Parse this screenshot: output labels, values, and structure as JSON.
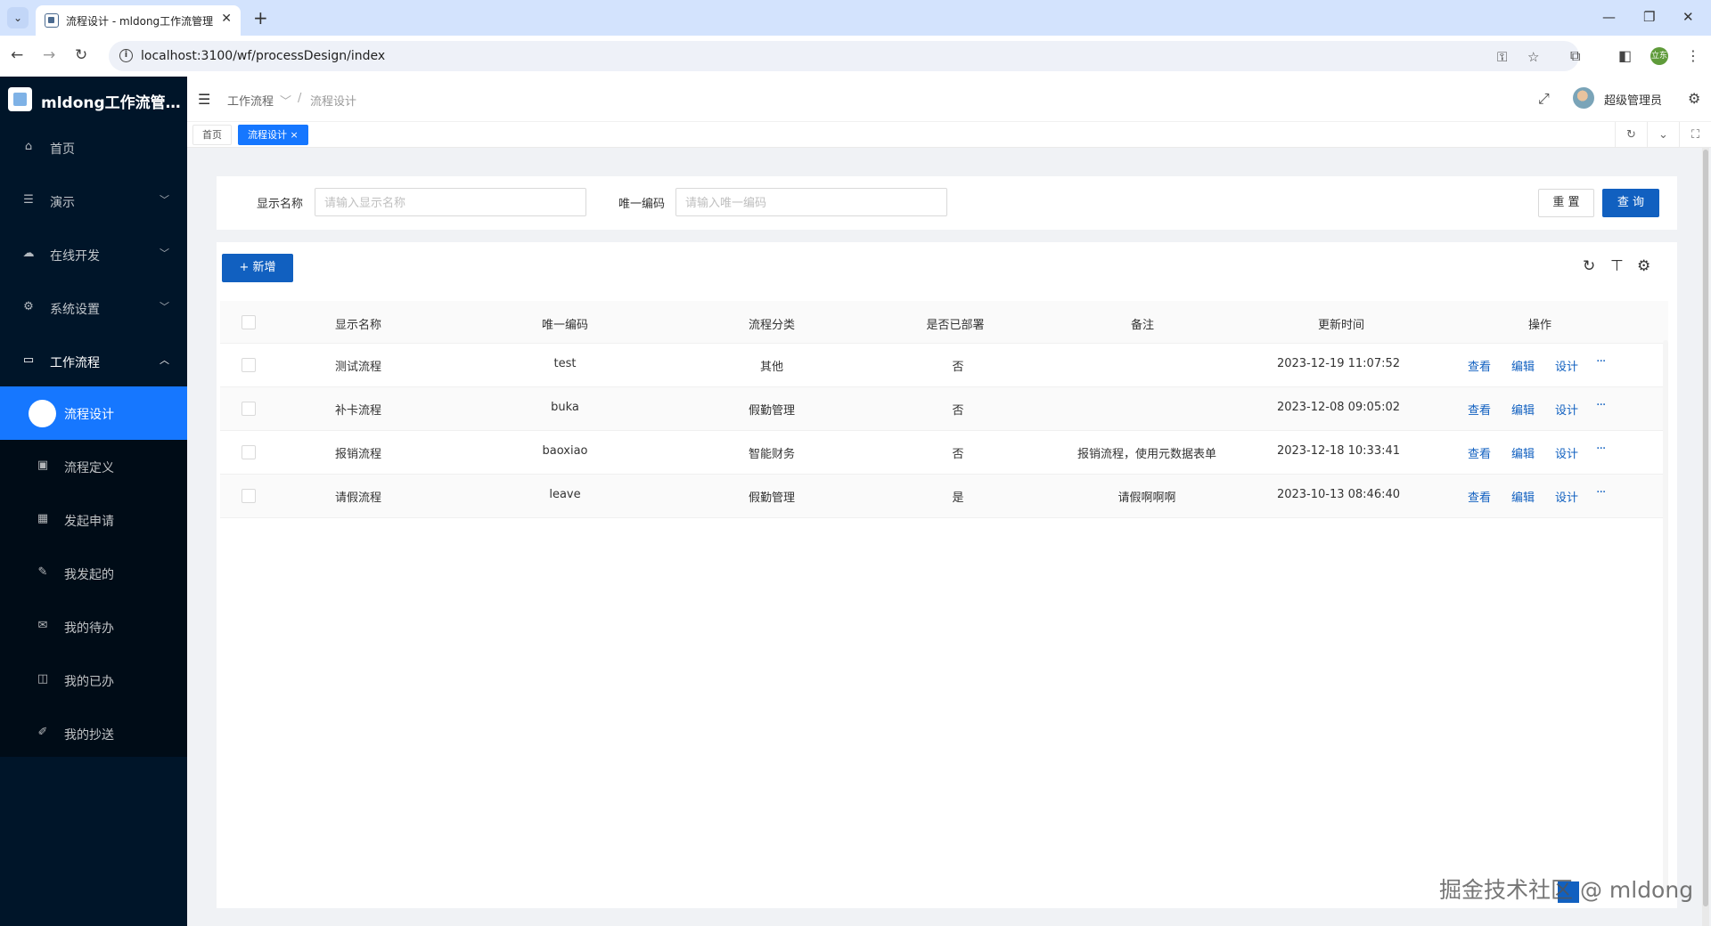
{
  "browser": {
    "tab_title": "流程设计 - mldong工作流管理",
    "url": "localhost:3100/wf/processDesign/index",
    "profile_initial": "立东"
  },
  "app": {
    "logo_text": "mldong工作流管理..."
  },
  "sidebar": {
    "items": [
      {
        "label": "首页",
        "icon": "home-icon"
      },
      {
        "label": "演示",
        "icon": "menu-lines-icon"
      },
      {
        "label": "在线开发",
        "icon": "cloud-icon"
      },
      {
        "label": "系统设置",
        "icon": "gear-icon"
      },
      {
        "label": "工作流程",
        "icon": "monitor-icon"
      }
    ],
    "sub_items": [
      {
        "label": "流程设计",
        "icon": "circle-icon",
        "active": true
      },
      {
        "label": "流程定义",
        "icon": "image-icon"
      },
      {
        "label": "发起申请",
        "icon": "grid-icon"
      },
      {
        "label": "我发起的",
        "icon": "edit-square-icon"
      },
      {
        "label": "我的待办",
        "icon": "mail-icon"
      },
      {
        "label": "我的已办",
        "icon": "book-icon"
      },
      {
        "label": "我的抄送",
        "icon": "pencil-icon"
      }
    ]
  },
  "header": {
    "breadcrumb": [
      "工作流程",
      "流程设计"
    ],
    "user_name": "超级管理员"
  },
  "page_tabs": [
    {
      "label": "首页"
    },
    {
      "label": "流程设计 ×",
      "active": true
    }
  ],
  "search": {
    "name_label": "显示名称",
    "name_placeholder": "请输入显示名称",
    "code_label": "唯一编码",
    "code_placeholder": "请输入唯一编码",
    "reset_label": "重 置",
    "query_label": "查 询"
  },
  "table": {
    "add_label": "+ 新增",
    "columns": [
      "显示名称",
      "唯一编码",
      "流程分类",
      "是否已部署",
      "备注",
      "更新时间",
      "操作"
    ],
    "rows": [
      {
        "name": "测试流程",
        "code": "test",
        "category": "其他",
        "deployed": "否",
        "remark": "",
        "updated": "2023-12-19 11:07:52"
      },
      {
        "name": "补卡流程",
        "code": "buka",
        "category": "假勤管理",
        "deployed": "否",
        "remark": "",
        "updated": "2023-12-08 09:05:02"
      },
      {
        "name": "报销流程",
        "code": "baoxiao",
        "category": "智能财务",
        "deployed": "否",
        "remark": "报销流程，使用元数据表单",
        "updated": "2023-12-18 10:33:41"
      },
      {
        "name": "请假流程",
        "code": "leave",
        "category": "假勤管理",
        "deployed": "是",
        "remark": "请假啊啊啊",
        "updated": "2023-10-13 08:46:40"
      }
    ],
    "actions": [
      "查看",
      "编辑",
      "设计",
      "···"
    ]
  },
  "watermark": "掘金技术社区 @ mldong"
}
